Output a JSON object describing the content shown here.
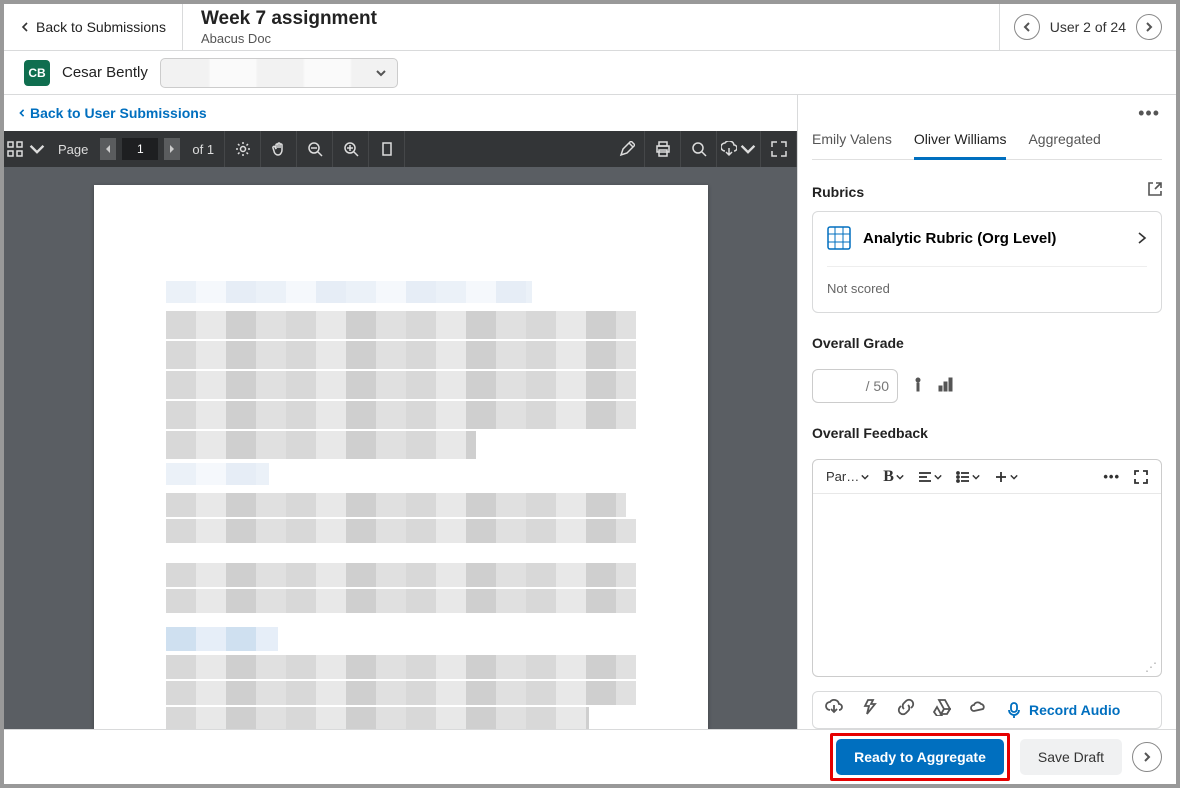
{
  "header": {
    "back_label": "Back to Submissions",
    "title": "Week 7 assignment",
    "subtitle": "Abacus Doc",
    "user_position": "User 2 of 24"
  },
  "student": {
    "initials": "CB",
    "name": "Cesar Bently"
  },
  "left": {
    "back_user_label": "Back to User Submissions",
    "toolbar": {
      "page_label": "Page",
      "page_current": "1",
      "page_total": "of 1"
    }
  },
  "right": {
    "tabs": [
      "Emily Valens",
      "Oliver Williams",
      "Aggregated"
    ],
    "active_tab_index": 1,
    "rubrics": {
      "heading": "Rubrics",
      "item_title": "Analytic Rubric (Org Level)",
      "status": "Not scored"
    },
    "grade": {
      "heading": "Overall Grade",
      "suffix": "/ 50"
    },
    "feedback": {
      "heading": "Overall Feedback",
      "format_label": "Par…"
    },
    "attach": {
      "record_label": "Record Audio"
    }
  },
  "footer": {
    "primary": "Ready to Aggregate",
    "secondary": "Save Draft"
  }
}
